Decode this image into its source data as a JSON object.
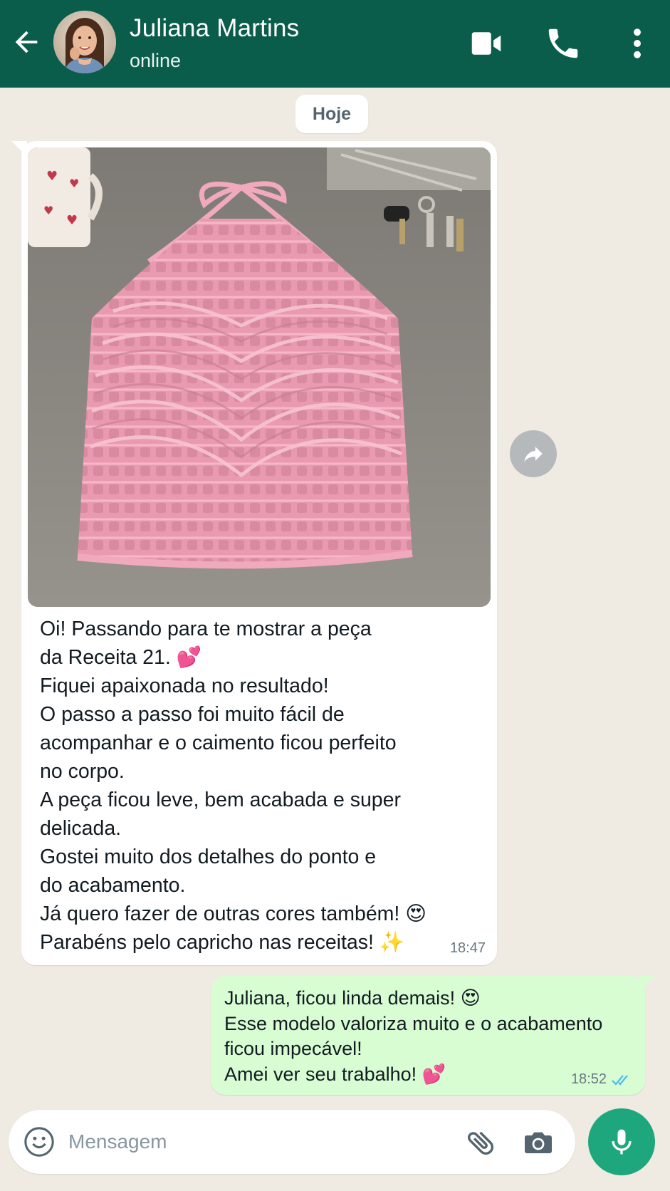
{
  "header": {
    "contact_name": "Juliana Martins",
    "status": "online",
    "icons": [
      "arrow-back-icon",
      "avatar",
      "video-call-icon",
      "phone-icon",
      "more-vert-icon"
    ]
  },
  "date_chip": "Hoje",
  "messages": [
    {
      "direction": "incoming",
      "has_image": true,
      "image_description_icon": "photo",
      "lines": [
        "Oi! Passando para te mostrar a peça",
        "da Receita 21. 💕",
        "Fiquei apaixonada no resultado!",
        "O passo a passo foi muito fácil de",
        "acompanhar e o caimento ficou perfeito",
        "no corpo.",
        "A peça ficou leve, bem acabada e super",
        "delicada.",
        "Gostei muito dos detalhes do ponto e",
        "do acabamento.",
        "Já quero fazer de outras cores também! 😍",
        "Parabéns pelo capricho nas receitas! ✨"
      ],
      "time": "18:47"
    },
    {
      "direction": "outgoing",
      "lines": [
        "Juliana, ficou linda demais! 😍",
        "Esse modelo valoriza muito e o acabamento",
        "ficou impecável!",
        "Amei ver seu trabalho! 💕"
      ],
      "time": "18:52",
      "read": true
    }
  ],
  "composer": {
    "placeholder": "Mensagem",
    "icons": [
      "emoji-icon",
      "attach-icon",
      "camera-icon",
      "mic-icon"
    ]
  },
  "colors": {
    "header_bg": "#0b5d4b",
    "chat_bg": "#efeae2",
    "incoming_bg": "#ffffff",
    "outgoing_bg": "#d9fdd3",
    "mic_bg": "#1ea77c",
    "read_ticks": "#53bdeb"
  }
}
